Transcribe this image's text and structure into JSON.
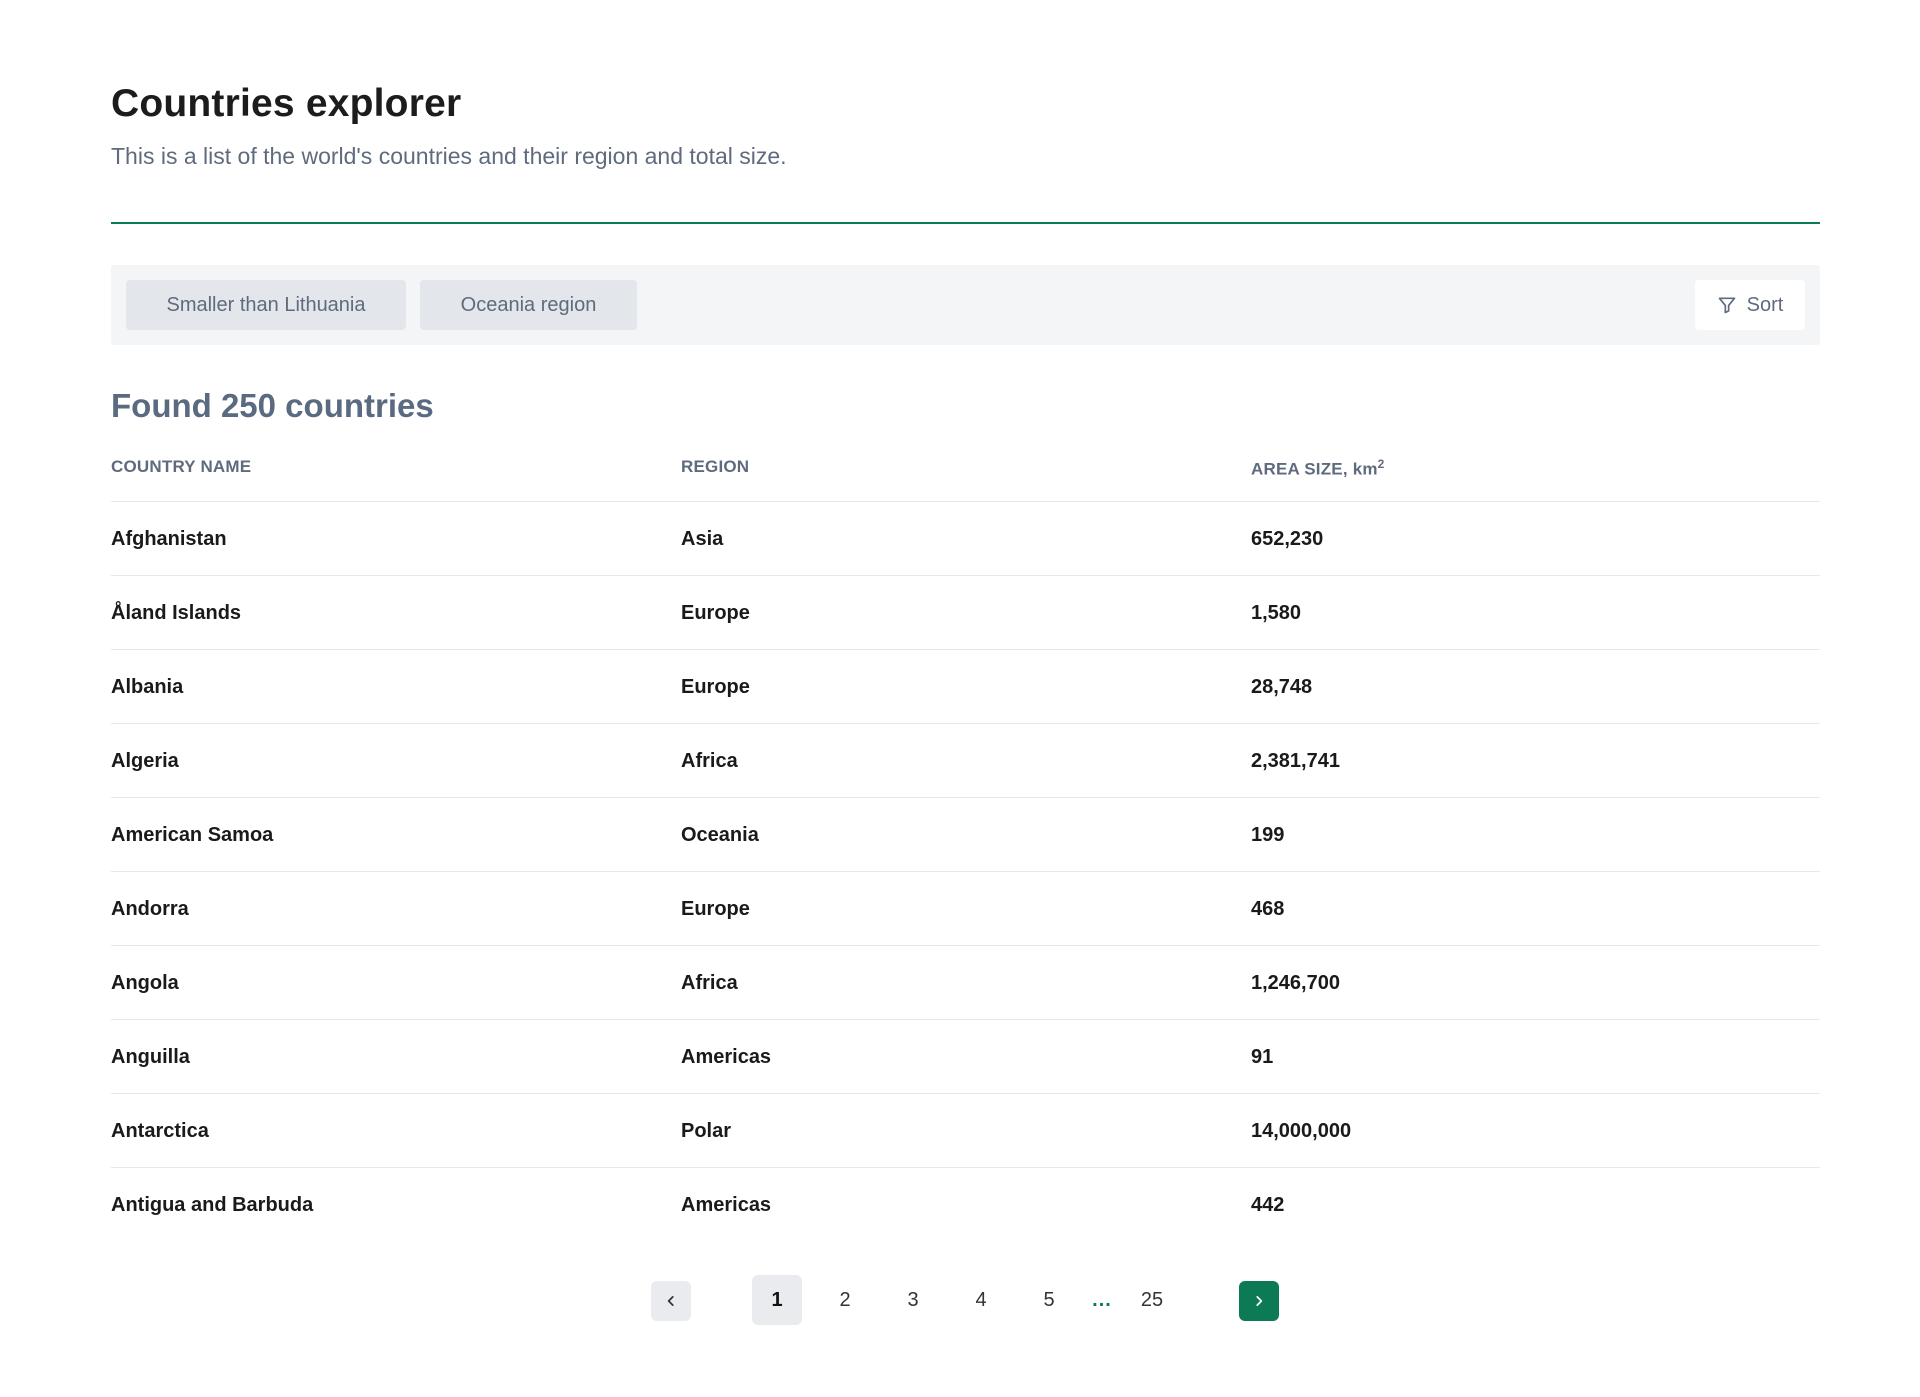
{
  "header": {
    "title": "Countries explorer",
    "subtitle": "This is a list of the world's countries and their region and total size."
  },
  "filters": {
    "chips": [
      "Smaller than Lithuania",
      "Oceania region"
    ],
    "sort_label": "Sort",
    "sort_icon": "filter-icon"
  },
  "results": {
    "title": "Found 250 countries"
  },
  "table": {
    "columns": [
      "COUNTRY NAME",
      "REGION",
      "AREA SIZE, km"
    ],
    "area_unit_superscript": "2",
    "rows": [
      {
        "name": "Afghanistan",
        "region": "Asia",
        "area": "652,230"
      },
      {
        "name": "Åland Islands",
        "region": "Europe",
        "area": "1,580"
      },
      {
        "name": "Albania",
        "region": "Europe",
        "area": "28,748"
      },
      {
        "name": "Algeria",
        "region": "Africa",
        "area": "2,381,741"
      },
      {
        "name": "American Samoa",
        "region": "Oceania",
        "area": "199"
      },
      {
        "name": "Andorra",
        "region": "Europe",
        "area": "468"
      },
      {
        "name": "Angola",
        "region": "Africa",
        "area": "1,246,700"
      },
      {
        "name": "Anguilla",
        "region": "Americas",
        "area": "91"
      },
      {
        "name": "Antarctica",
        "region": "Polar",
        "area": "14,000,000"
      },
      {
        "name": "Antigua and Barbuda",
        "region": "Americas",
        "area": "442"
      }
    ]
  },
  "pagination": {
    "prev_icon": "chevron-left-icon",
    "next_icon": "chevron-right-icon",
    "pages": [
      "1",
      "2",
      "3",
      "4",
      "5"
    ],
    "ellipsis": "...",
    "last_page": "25",
    "current_page": "1",
    "accent_color": "#0c7a55"
  }
}
